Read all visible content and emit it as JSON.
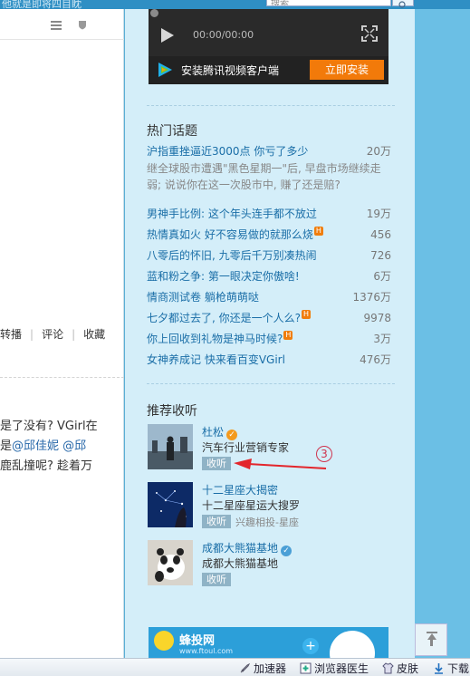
{
  "topbar": {
    "truncated_text": "他就是即将四目眈",
    "search_placeholder": "搜索"
  },
  "main": {
    "actions": [
      "转播",
      "评论",
      "收藏"
    ],
    "post_lines": [
      {
        "parts": [
          {
            "text": "是了没有? VGirl在",
            "link": false
          }
        ]
      },
      {
        "parts": [
          {
            "text": "是",
            "link": false
          },
          {
            "text": "@邱佳妮",
            "link": true
          },
          {
            "text": " ",
            "link": false
          },
          {
            "text": "@邱",
            "link": true
          }
        ]
      },
      {
        "parts": [
          {
            "text": "鹿乱撞呢? 趁着万",
            "link": false
          }
        ]
      }
    ]
  },
  "player": {
    "time": "00:00/00:00",
    "install_text": "安装腾讯视频客户端",
    "install_button": "立即安装"
  },
  "hot_topics": {
    "title": "热门话题",
    "featured": {
      "title": "沪指重挫逼近3000点 你亏了多少",
      "count": "20万",
      "desc": "继全球股市遭遇\"黑色星期一\"后, 早盘市场继续走弱; 说说你在这一次股市中, 赚了还是赔?"
    },
    "items": [
      {
        "title": "男神手比例: 这个年头连手都不放过",
        "count": "19万",
        "hot": false
      },
      {
        "title": "热情真如火 好不容易做的就那么烧",
        "count": "456",
        "hot": true
      },
      {
        "title": "八零后的怀旧, 九零后千万别凑热闹",
        "count": "726",
        "hot": false
      },
      {
        "title": "蓝和粉之争: 第一眼决定你傲啥!",
        "count": "6万",
        "hot": false
      },
      {
        "title": "情商测试卷 躺枪萌萌哒",
        "count": "1376万",
        "hot": false
      },
      {
        "title": "七夕都过去了, 你还是一个人么?",
        "count": "9978",
        "hot": true
      },
      {
        "title": "你上回收到礼物是神马时候?",
        "count": "3万",
        "hot": true
      },
      {
        "title": "女神养成记 快来看百变VGirl",
        "count": "476万",
        "hot": false
      }
    ],
    "hot_badge": "H"
  },
  "recommend": {
    "title": "推荐收听",
    "follow_label": "收听",
    "annotation": "3",
    "items": [
      {
        "name": "杜松",
        "desc": "汽车行业营销专家",
        "tag": "",
        "verified": "orange",
        "avatar": "city"
      },
      {
        "name": "十二星座大揭密",
        "desc": "十二星座星运大搜罗",
        "tag": "兴趣相投-星座",
        "verified": "",
        "avatar": "stars"
      },
      {
        "name": "成都大熊猫基地",
        "desc": "成都大熊猫基地",
        "tag": "",
        "verified": "blue",
        "avatar": "panda"
      }
    ]
  },
  "ad": {
    "brand": "蜂投网",
    "sub": "www.ftoul.com"
  },
  "statusbar": {
    "items": [
      "加速器",
      "浏览器医生",
      "皮肤",
      "下载"
    ]
  },
  "colors": {
    "link": "#1a6ea7",
    "accent_orange": "#f27a0a",
    "panel_bg": "#d4eef9",
    "annotation_red": "#d0344e"
  }
}
